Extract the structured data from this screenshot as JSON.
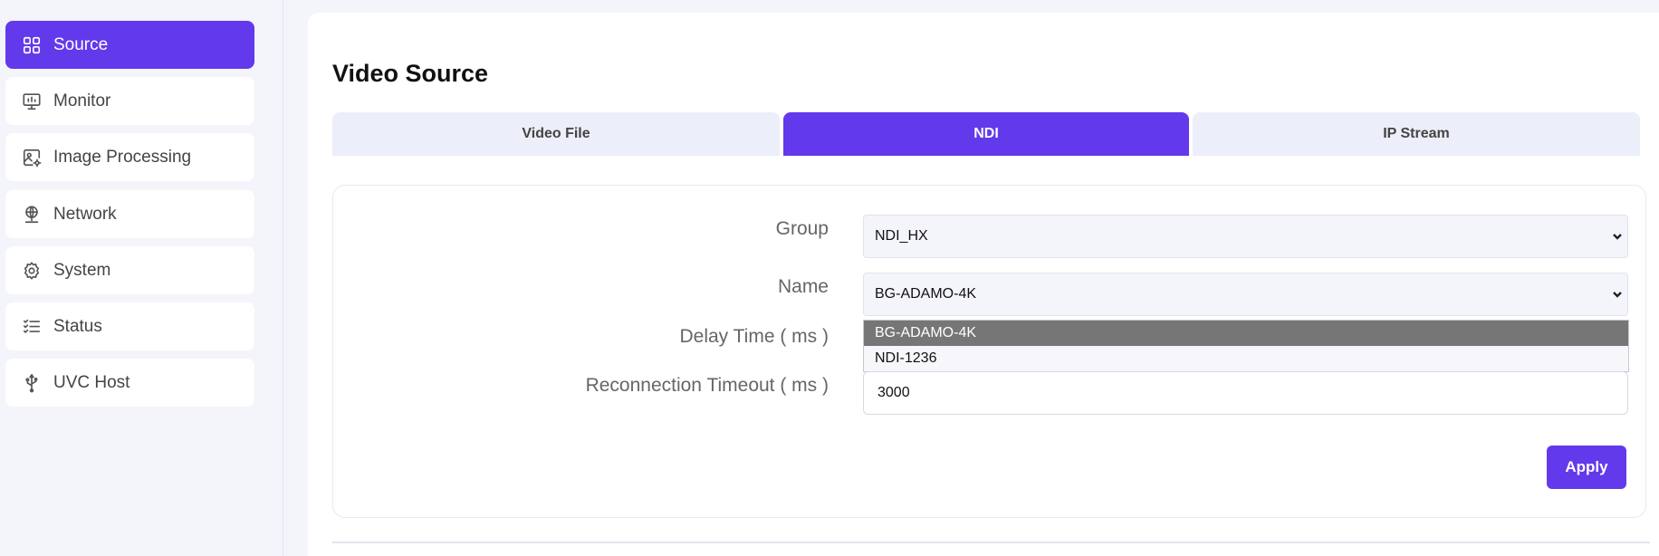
{
  "sidebar": {
    "items": [
      {
        "label": "Source",
        "icon": "grid-icon",
        "active": true
      },
      {
        "label": "Monitor",
        "icon": "monitor-icon",
        "active": false
      },
      {
        "label": "Image Processing",
        "icon": "image-settings-icon",
        "active": false
      },
      {
        "label": "Network",
        "icon": "globe-network-icon",
        "active": false
      },
      {
        "label": "System",
        "icon": "gear-icon",
        "active": false
      },
      {
        "label": "Status",
        "icon": "checklist-icon",
        "active": false
      },
      {
        "label": "UVC Host",
        "icon": "usb-icon",
        "active": false
      }
    ]
  },
  "main": {
    "title": "Video Source",
    "tabs": [
      {
        "label": "Video File",
        "active": false
      },
      {
        "label": "NDI",
        "active": true
      },
      {
        "label": "IP Stream",
        "active": false
      }
    ],
    "form": {
      "group_label": "Group",
      "group_value": "NDI_HX",
      "name_label": "Name",
      "name_value": "BG-ADAMO-4K",
      "name_options": [
        "BG-ADAMO-4K",
        "NDI-1236"
      ],
      "delay_label": "Delay Time ( ms )",
      "reconnect_label": "Reconnection Timeout ( ms )",
      "reconnect_value": "3000",
      "apply_label": "Apply"
    }
  },
  "colors": {
    "accent": "#6339ec",
    "background": "#f4f4fb",
    "tab_inactive": "#eceefa",
    "option_selected": "#767676"
  }
}
